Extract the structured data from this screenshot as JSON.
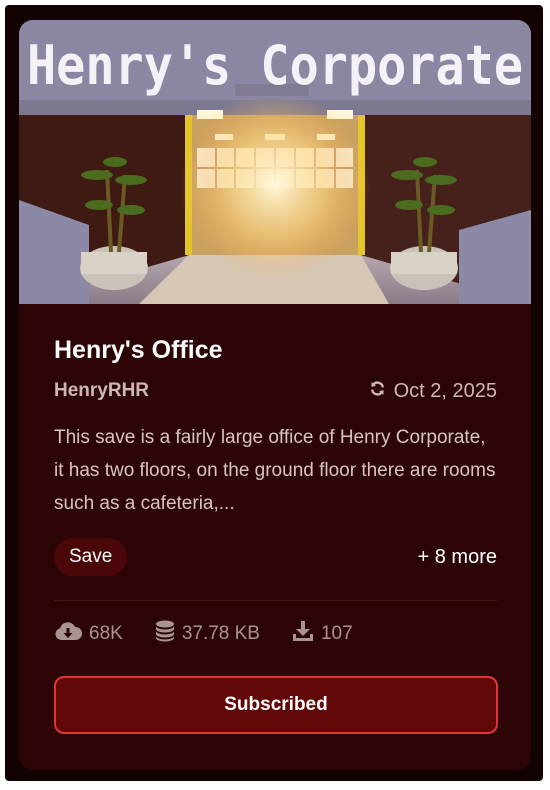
{
  "item": {
    "thumbnail_text": "Henry's Corporate",
    "title": "Henry's Office",
    "author": "HenryRHR",
    "updated_date": "Oct 2, 2025",
    "description": "This save is a fairly large office of Henry Corporate, it has two floors, on the ground floor there are rooms such as a cafeteria,...",
    "tag": "Save",
    "more_tags": "+ 8 more",
    "stats": {
      "subscribers": "68K",
      "file_size": "37.78 KB",
      "downloads": "107"
    },
    "subscribe_button_label": "Subscribed"
  },
  "colors": {
    "card_background": "#2c0405",
    "button_background": "#620708",
    "button_border": "#e03436"
  },
  "icons": {
    "update": "refresh-icon",
    "subscribers": "cloud-download-icon",
    "file_size": "database-icon",
    "downloads": "download-icon"
  }
}
